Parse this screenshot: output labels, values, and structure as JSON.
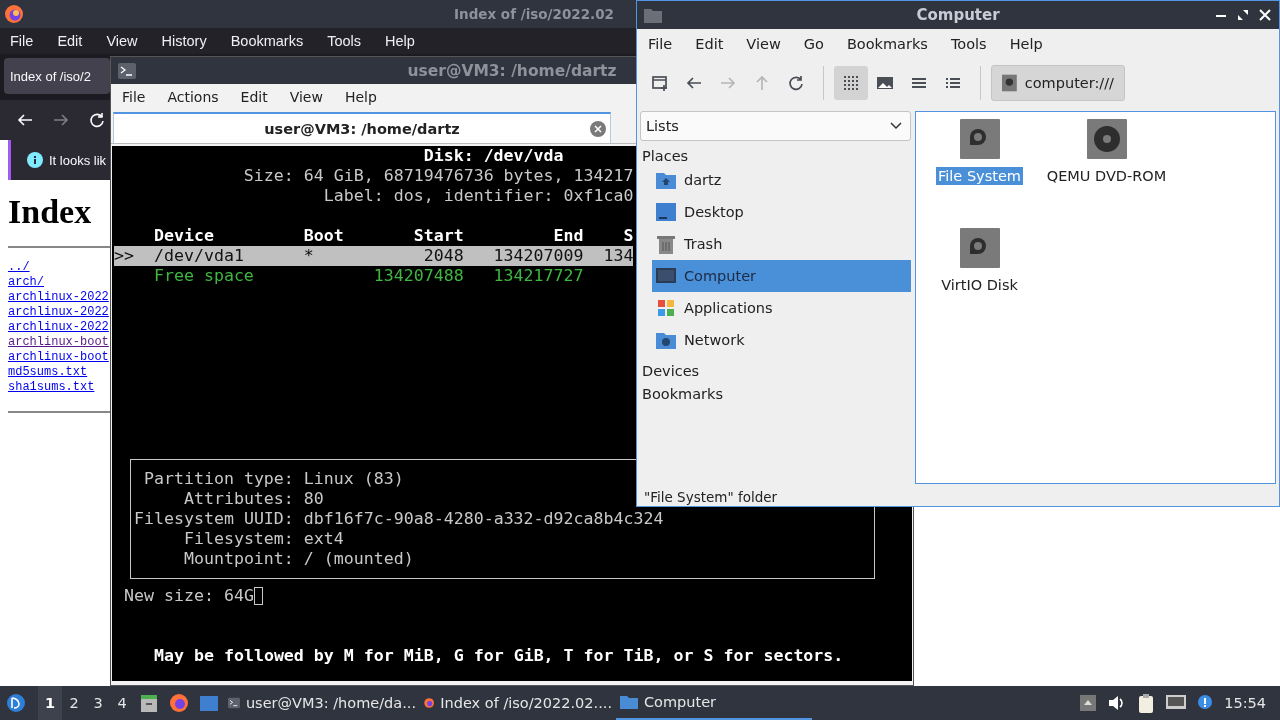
{
  "browser": {
    "title": "Index of /iso/2022.02",
    "menu": [
      "File",
      "Edit",
      "View",
      "History",
      "Bookmarks",
      "Tools",
      "Help"
    ],
    "tabs": [
      {
        "label": "Index of /iso/2",
        "selected": true
      }
    ],
    "nav": [
      {
        "kind": "back",
        "disabled": false
      },
      {
        "kind": "forward",
        "disabled": true
      },
      {
        "kind": "reload",
        "disabled": false
      }
    ],
    "notification": "It looks lik",
    "heading": "Index",
    "links": [
      {
        "label": "../",
        "visited": false
      },
      {
        "label": "arch/",
        "visited": false
      },
      {
        "label": "archlinux-2022",
        "visited": false
      },
      {
        "label": "archlinux-2022",
        "visited": false
      },
      {
        "label": "archlinux-2022",
        "visited": false
      },
      {
        "label": "archlinux-boot",
        "visited": true
      },
      {
        "label": "archlinux-boot",
        "visited": false
      },
      {
        "label": "md5sums.txt",
        "visited": false
      },
      {
        "label": "sha1sums.txt",
        "visited": false
      }
    ]
  },
  "terminal": {
    "title": "user@VM3: /home/dartz",
    "menu": [
      "File",
      "Actions",
      "Edit",
      "View",
      "Help"
    ],
    "tabs": [
      {
        "label": "user@VM3: /home/dartz",
        "selected": true
      }
    ],
    "header_lines": [
      "Disk: /dev/vda",
      "Size: 64 GiB, 68719476736 bytes, 134217",
      "Label: dos, identifier: 0xf1ca0"
    ],
    "table": {
      "columns": [
        "Device",
        "Boot",
        "Start",
        "End",
        "S"
      ],
      "rows": [
        {
          "kind": "partition",
          "selected": true,
          "marker": ">>",
          "device": "/dev/vda1",
          "boot": "*",
          "start": "2048",
          "end": "134207009",
          "column_5": "134"
        },
        {
          "kind": "free",
          "selected": false,
          "device": "Free space",
          "start": "134207488",
          "end": "134217727"
        }
      ]
    },
    "details": [
      {
        "label": "Partition type:",
        "value": "Linux (83)"
      },
      {
        "label": "Attributes:",
        "value": "80"
      },
      {
        "label": "Filesystem UUID:",
        "value": "dbf16f7c-90a8-4280-a332-d92ca8b4c324"
      },
      {
        "label": "Filesystem:",
        "value": "ext4"
      },
      {
        "label": "Mountpoint:",
        "value": "/ (mounted)"
      }
    ],
    "prompt": "New size: 64G",
    "hint": "May be followed by M for MiB, G for GiB, T for TiB, or S for sectors."
  },
  "file_manager": {
    "title": "Computer",
    "menu": [
      "File",
      "Edit",
      "View",
      "Go",
      "Bookmarks",
      "Tools",
      "Help"
    ],
    "toolbar": [
      {
        "kind": "new-tab",
        "disabled": false
      },
      {
        "kind": "back",
        "disabled": false
      },
      {
        "kind": "forward",
        "disabled": true
      },
      {
        "kind": "up",
        "disabled": true
      },
      {
        "kind": "reload",
        "disabled": false
      }
    ],
    "view_modes": [
      {
        "kind": "icons",
        "selected": true
      },
      {
        "kind": "thumbnails",
        "selected": false
      },
      {
        "kind": "compact",
        "selected": false
      },
      {
        "kind": "details",
        "selected": false
      }
    ],
    "location": "computer:///",
    "side_pane_mode": "Lists",
    "sections": [
      {
        "title": "Places",
        "items": [
          {
            "label": "dartz",
            "kind": "home",
            "selected": false
          },
          {
            "label": "Desktop",
            "kind": "desktop",
            "selected": false
          },
          {
            "label": "Trash",
            "kind": "trash",
            "selected": false
          },
          {
            "label": "Computer",
            "kind": "computer",
            "selected": true
          },
          {
            "label": "Applications",
            "kind": "applications",
            "selected": false
          },
          {
            "label": "Network",
            "kind": "network",
            "selected": false
          }
        ]
      },
      {
        "title": "Devices"
      },
      {
        "title": "Bookmarks"
      }
    ],
    "items": [
      {
        "label": "File System",
        "kind": "disk",
        "selected": true
      },
      {
        "label": "QEMU DVD-ROM",
        "kind": "optical",
        "selected": false
      },
      {
        "label": "VirtIO Disk",
        "kind": "disk",
        "selected": false
      }
    ],
    "status": "\"File System\" folder"
  },
  "taskbar": {
    "workspaces": [
      {
        "label": "1",
        "selected": true
      },
      {
        "label": "2",
        "selected": false
      },
      {
        "label": "3",
        "selected": false
      },
      {
        "label": "4",
        "selected": false
      }
    ],
    "launchers": [
      {
        "kind": "files"
      },
      {
        "kind": "browser"
      },
      {
        "kind": "desktop"
      }
    ],
    "tasks": [
      {
        "label": "user@VM3: /home/da...",
        "kind": "terminal",
        "selected": false
      },
      {
        "label": "Index of /iso/2022.02....",
        "kind": "browser",
        "selected": false
      },
      {
        "label": "Computer",
        "kind": "folder",
        "selected": true
      }
    ],
    "clock": "15:54"
  }
}
